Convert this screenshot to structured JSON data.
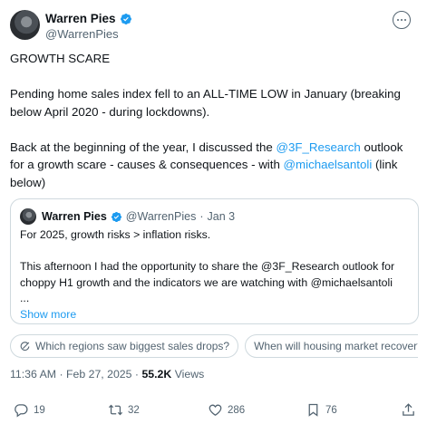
{
  "author": {
    "name": "Warren Pies",
    "handle": "@WarrenPies"
  },
  "tweet": {
    "line1": "GROWTH SCARE",
    "line2": "Pending home sales index fell to an ALL-TIME LOW in January (breaking below April 2020 - during lockdowns).",
    "line3_a": "Back at the beginning of the year, I discussed the ",
    "line3_link1": "@3F_Research",
    "line3_b": " outlook for a growth scare - causes & consequences - with ",
    "line3_link2": "@michaelsantoli",
    "line3_c": " (link below)"
  },
  "quote": {
    "name": "Warren Pies",
    "handle": "@WarrenPies",
    "dot": "·",
    "date": "Jan 3",
    "line1": "For 2025, growth risks > inflation risks.",
    "line2": "This afternoon I had the opportunity to share the @3F_Research outlook for choppy H1 growth and the indicators we are watching with @michaelsantoli",
    "ellipsis": "...",
    "show_more": "Show more"
  },
  "chips": [
    "Which regions saw biggest sales drops?",
    "When will housing market recover?"
  ],
  "meta": {
    "time": "11:36 AM",
    "sep1": "·",
    "date": "Feb 27, 2025",
    "sep2": "·",
    "views_count": "55.2K",
    "views_label": "Views"
  },
  "actions": {
    "replies": "19",
    "reposts": "32",
    "likes": "286",
    "bookmarks": "76"
  },
  "colors": {
    "accent": "#1d9bf0",
    "text": "#0f1419",
    "muted": "#536471",
    "border": "#cfd9de"
  },
  "icons": [
    "verified-badge-icon",
    "more-icon",
    "grok-icon",
    "reply-icon",
    "repost-icon",
    "like-icon",
    "bookmark-icon",
    "share-icon"
  ]
}
